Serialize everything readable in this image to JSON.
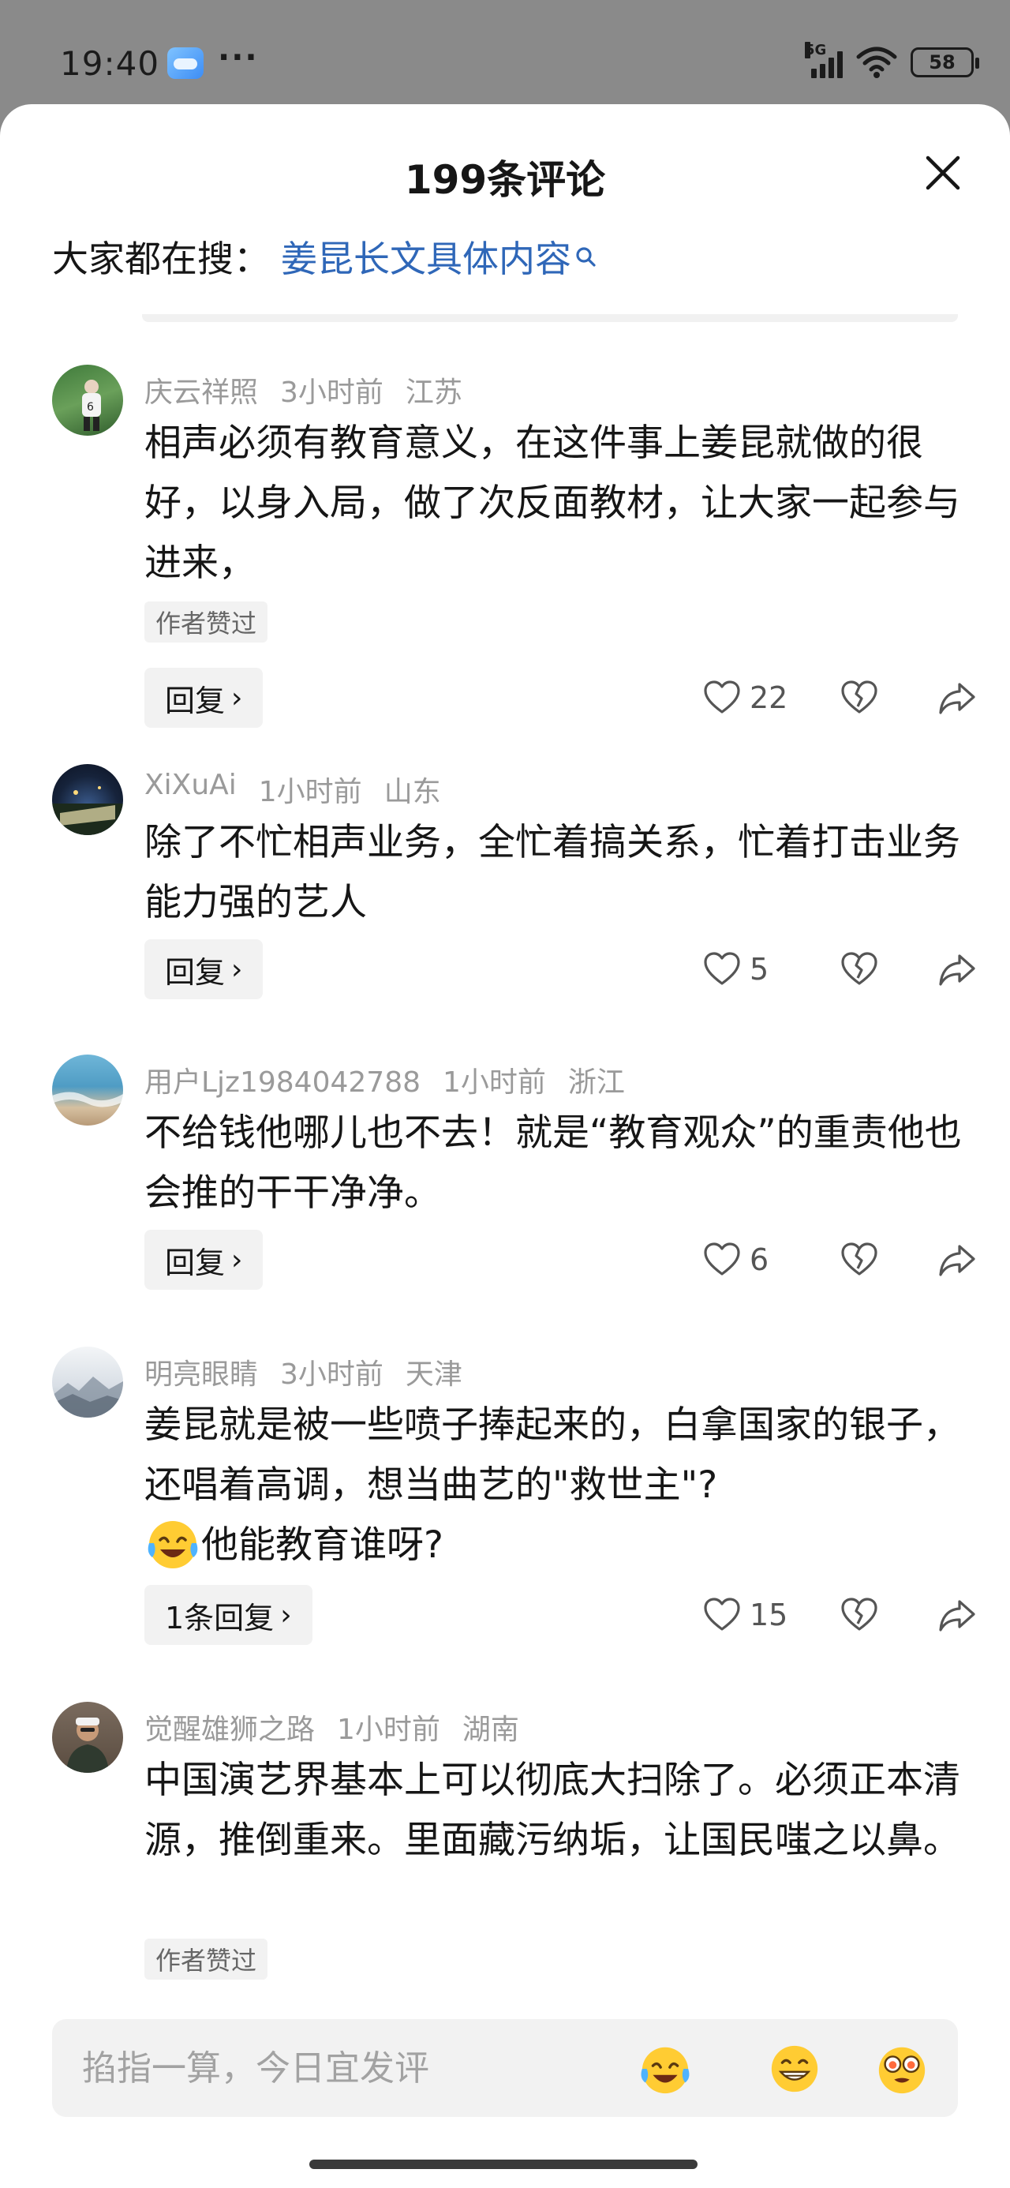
{
  "status_bar": {
    "time": "19:40",
    "more": "···",
    "network": "5G",
    "battery": "58"
  },
  "sheet": {
    "title": "199条评论",
    "hot_search_label": "大家都在搜：",
    "hot_search_term": "姜昆长文具体内容"
  },
  "comments": [
    {
      "user": "庆云祥照",
      "time": "3小时前",
      "location": "江苏",
      "text": "相声必须有教育意义，在这件事上姜昆就做的很好，以身入局，做了次反面教材，让大家一起参与进来，",
      "author_liked": "作者赞过",
      "reply_label": "回复",
      "likes": "22"
    },
    {
      "user": "XiXuAi",
      "time": "1小时前",
      "location": "山东",
      "text": "除了不忙相声业务，全忙着搞关系，忙着打击业务能力强的艺人",
      "reply_label": "回复",
      "likes": "5"
    },
    {
      "user": "用户Ljz1984042788",
      "time": "1小时前",
      "location": "浙江",
      "text": "不给钱他哪儿也不去！就是“教育观众”的重责他也会推的干干净净。",
      "reply_label": "回复",
      "likes": "6"
    },
    {
      "user": "明亮眼睛",
      "time": "3小时前",
      "location": "天津",
      "text": "姜昆就是被一些喷子捧起来的，白拿国家的银子，还唱着高调，想当曲艺的\"救世主\"?",
      "text_after_emoji": "他能教育谁呀?",
      "reply_label": "1条回复",
      "likes": "15"
    },
    {
      "user": "觉醒雄狮之路",
      "time": "1小时前",
      "location": "湖南",
      "text": "中国演艺界基本上可以彻底大扫除了。必须正本清源，推倒重来。里面藏污纳垢，让国民嗤之以鼻。",
      "author_liked": "作者赞过"
    }
  ],
  "input": {
    "placeholder": "掐指一算，今日宜发评"
  },
  "icons": {
    "close": "close-icon",
    "search": "search-icon",
    "like": "heart-icon",
    "dislike": "broken-heart-icon",
    "share": "share-icon"
  },
  "colors": {
    "link": "#2f67b8",
    "meta": "#9a9a9a",
    "text": "#161616"
  }
}
